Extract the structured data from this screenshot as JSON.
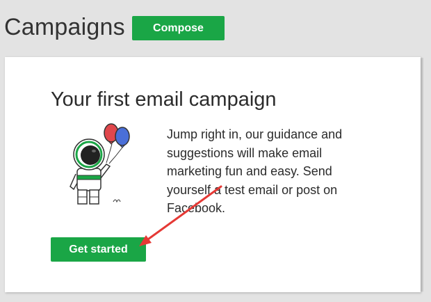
{
  "header": {
    "title": "Campaigns",
    "compose_label": "Compose"
  },
  "card": {
    "title": "Your first email campaign",
    "body": "Jump right in, our guidance and suggestions will make email marketing fun and easy. Send yourself a test email or post on Facebook.",
    "cta_label": "Get started"
  },
  "illustration": {
    "icon": "astronaut-with-balloons-icon",
    "balloon_colors": [
      "#e0474c",
      "#4a6fd8"
    ],
    "accent": "#1aa646"
  },
  "annotation": {
    "icon": "red-arrow-icon",
    "color": "#e53935"
  },
  "colors": {
    "brand_green": "#1aa646",
    "page_background": "#e3e3e3"
  }
}
